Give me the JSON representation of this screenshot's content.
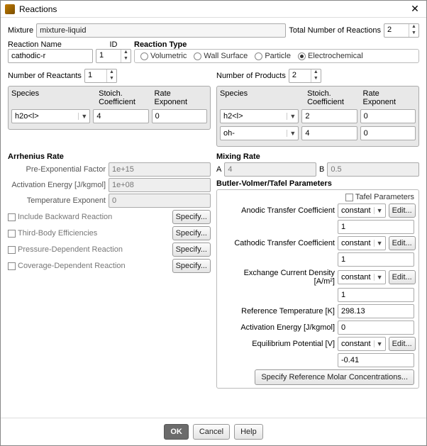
{
  "window": {
    "title": "Reactions",
    "close_glyph": "✕"
  },
  "top": {
    "mixture_label": "Mixture",
    "mixture_value": "mixture-liquid",
    "total_label": "Total Number of Reactions",
    "total_value": "2"
  },
  "rxn": {
    "name_label": "Reaction Name",
    "name_value": "cathodic-r",
    "id_label": "ID",
    "id_value": "1",
    "type_label": "Reaction Type",
    "types": {
      "volumetric": "Volumetric",
      "wall": "Wall Surface",
      "particle": "Particle",
      "echem": "Electrochemical"
    },
    "type_selected": "echem"
  },
  "reactants": {
    "count_label": "Number of Reactants",
    "count_value": "1",
    "headers": {
      "species": "Species",
      "stoich": "Stoich.\nCoefficient",
      "rate": "Rate\nExponent"
    },
    "rows": [
      {
        "species": "h2o<l>",
        "stoich": "4",
        "rate": "0"
      }
    ]
  },
  "products": {
    "count_label": "Number of Products",
    "count_value": "2",
    "headers": {
      "species": "Species",
      "stoich": "Stoich.\nCoefficient",
      "rate": "Rate\nExponent"
    },
    "rows": [
      {
        "species": "h2<l>",
        "stoich": "2",
        "rate": "0"
      },
      {
        "species": "oh-",
        "stoich": "4",
        "rate": "0"
      }
    ]
  },
  "arrhenius": {
    "title": "Arrhenius Rate",
    "pre_label": "Pre-Exponential Factor",
    "pre_value": "1e+15",
    "act_label": "Activation Energy [J/kgmol]",
    "act_value": "1e+08",
    "texp_label": "Temperature Exponent",
    "texp_value": "0",
    "include_backward": "Include Backward Reaction",
    "third_body": "Third-Body Efficiencies",
    "pressure_dep": "Pressure-Dependent Reaction",
    "coverage_dep": "Coverage-Dependent Reaction",
    "specify": "Specify..."
  },
  "mixing": {
    "title": "Mixing Rate",
    "a_label": "A",
    "a_value": "4",
    "b_label": "B",
    "b_value": "0.5"
  },
  "bv": {
    "title": "Butler-Volmer/Tafel Parameters",
    "tafel_chk": "Tafel Parameters",
    "anodic_label": "Anodic Transfer Coefficient",
    "anodic_combo": "constant",
    "anodic_val": "1",
    "cathodic_label": "Cathodic Transfer Coefficient",
    "cathodic_combo": "constant",
    "cathodic_val": "1",
    "ecd_label": "Exchange Current Density [A/m²]",
    "ecd_combo": "constant",
    "ecd_val": "1",
    "reft_label": "Reference Temperature [K]",
    "reft_val": "298.13",
    "act_label": "Activation Energy [J/kgmol]",
    "act_val": "0",
    "eq_label": "Equilibrium Potential [V]",
    "eq_combo": "constant",
    "eq_val": "-0.41",
    "edit": "Edit...",
    "specify_ref": "Specify Reference Molar Concentrations..."
  },
  "footer": {
    "ok": "OK",
    "cancel": "Cancel",
    "help": "Help"
  }
}
